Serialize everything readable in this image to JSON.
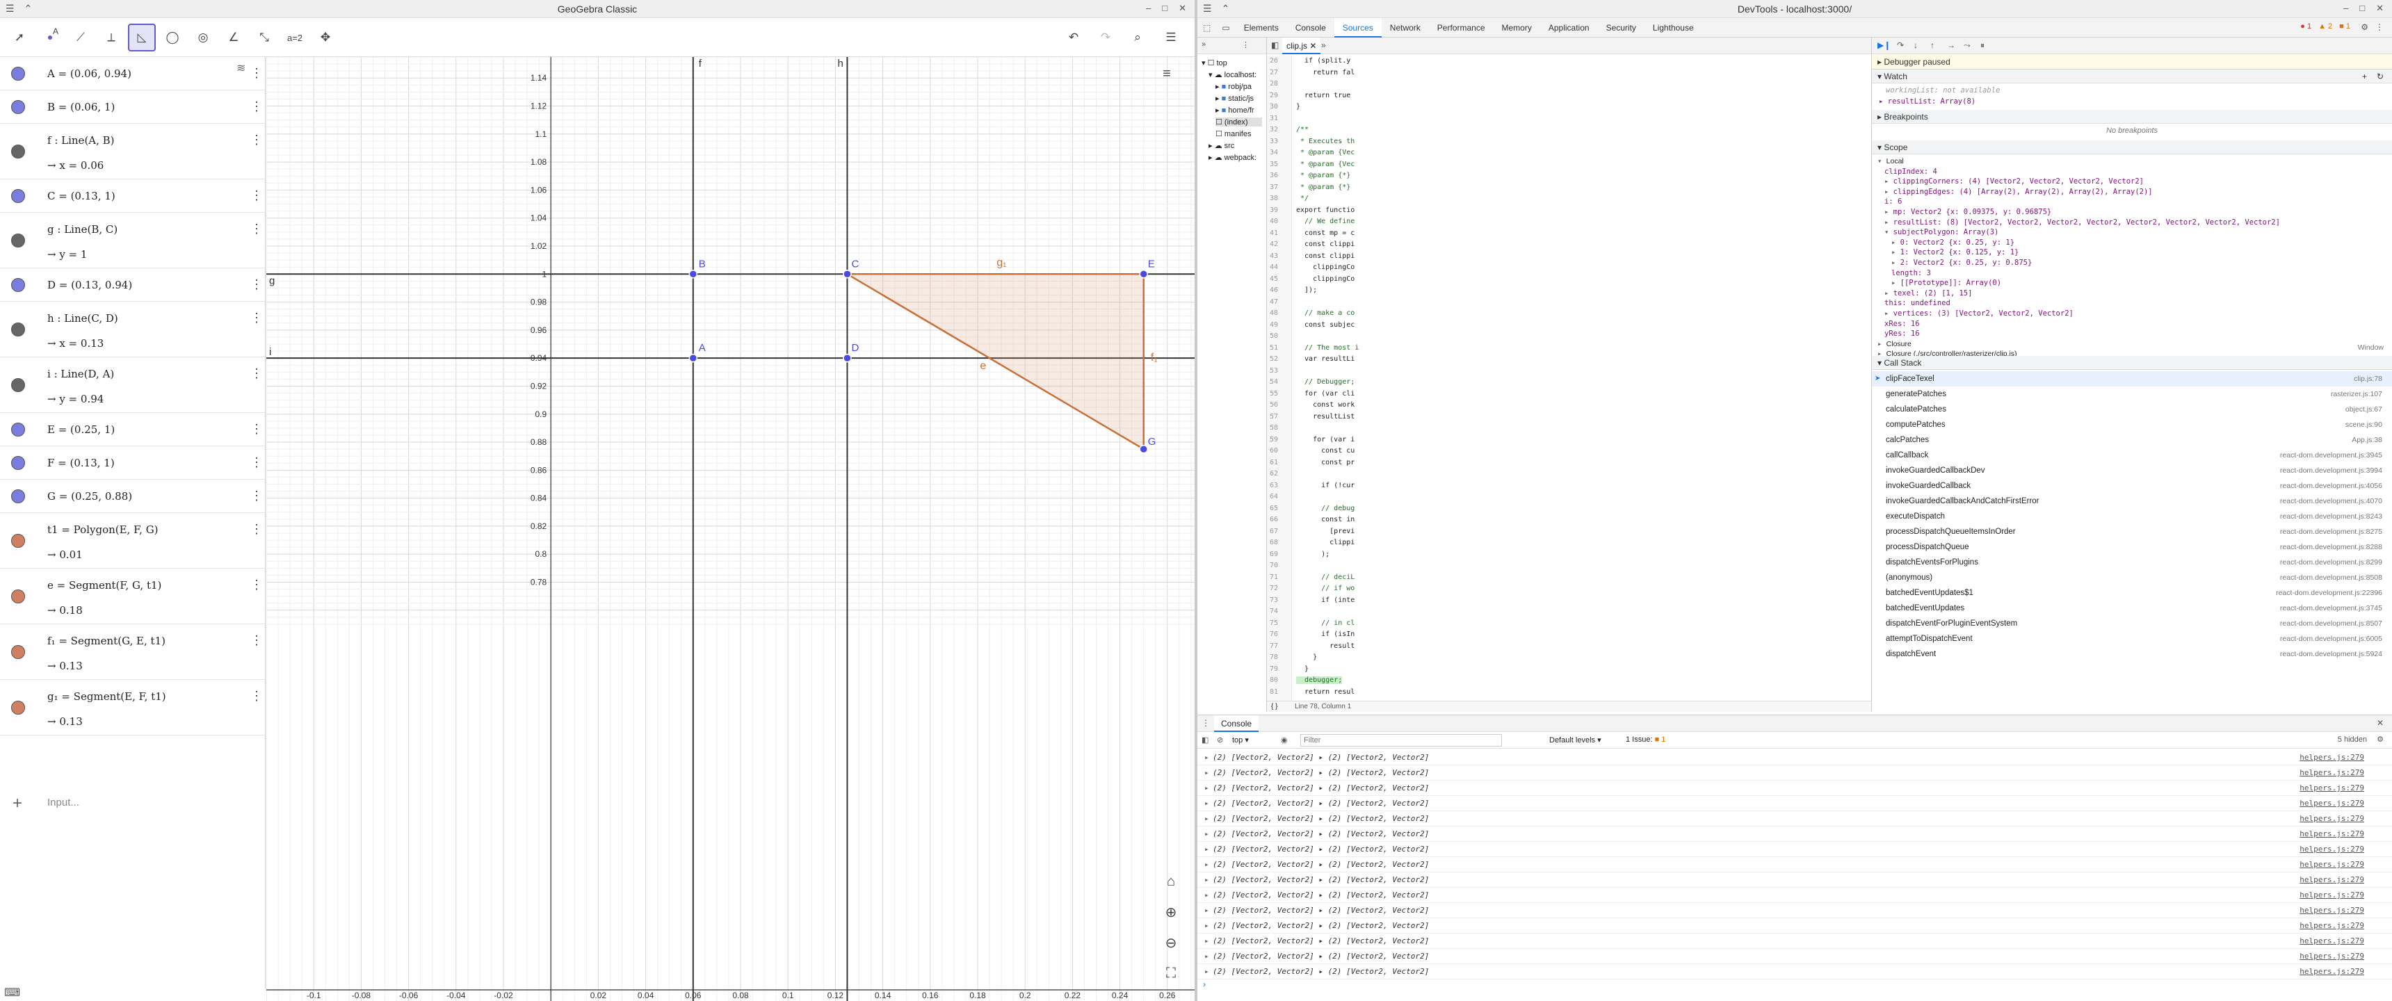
{
  "geogebra": {
    "title": "GeoGebra Classic",
    "algebra": [
      {
        "def": "A = (0.06, 0.94)",
        "val": "",
        "color": "#7c7ce0"
      },
      {
        "def": "B = (0.06, 1)",
        "val": "",
        "color": "#7c7ce0"
      },
      {
        "def": "f : Line(A, B)",
        "val": "→  x = 0.06",
        "color": "#666666"
      },
      {
        "def": "C = (0.13, 1)",
        "val": "",
        "color": "#7c7ce0"
      },
      {
        "def": "g : Line(B, C)",
        "val": "→  y = 1",
        "color": "#666666"
      },
      {
        "def": "D = (0.13, 0.94)",
        "val": "",
        "color": "#7c7ce0"
      },
      {
        "def": "h : Line(C, D)",
        "val": "→  x = 0.13",
        "color": "#666666"
      },
      {
        "def": "i : Line(D, A)",
        "val": "→  y = 0.94",
        "color": "#666666"
      },
      {
        "def": "E = (0.25, 1)",
        "val": "",
        "color": "#7c7ce0"
      },
      {
        "def": "F = (0.13, 1)",
        "val": "",
        "color": "#7c7ce0"
      },
      {
        "def": "G = (0.25, 0.88)",
        "val": "",
        "color": "#7c7ce0"
      },
      {
        "def": "t1 = Polygon(E, F, G)",
        "val": "→  0.01",
        "color": "#d08060"
      },
      {
        "def": "e = Segment(F, G, t1)",
        "val": "→  0.18",
        "color": "#d08060"
      },
      {
        "def": "f₁ = Segment(G, E, t1)",
        "val": "→  0.13",
        "color": "#d08060"
      },
      {
        "def": "g₁ = Segment(E, F, t1)",
        "val": "→  0.13",
        "color": "#d08060"
      }
    ],
    "input_placeholder": "Input...",
    "xticks": [
      "-0.1",
      "-0.08",
      "-0.06",
      "-0.04",
      "-0.02",
      "0.02",
      "0.04",
      "0.06",
      "0.08",
      "0.1",
      "0.12",
      "0.14",
      "0.16",
      "0.18",
      "0.2",
      "0.22",
      "0.24",
      "0.26"
    ],
    "yticks": [
      "1.14",
      "1.12",
      "1.1",
      "1.08",
      "1.06",
      "1.04",
      "1.02",
      "1",
      "0.98",
      "0.96",
      "0.94",
      "0.92",
      "0.9",
      "0.88",
      "0.86",
      "0.84",
      "0.82",
      "0.8",
      "0.78"
    ],
    "line_labels": {
      "f": "f",
      "h": "h",
      "g": "g",
      "i": "i"
    },
    "point_labels": {
      "A": "A",
      "B": "B",
      "C": "C",
      "D": "D",
      "E": "E",
      "G": "G"
    },
    "segment_labels": {
      "e": "e",
      "f1": "f₁",
      "g1": "g₁"
    },
    "colors": {
      "point": "#4a4ae0",
      "polygon": "#c8703a",
      "polygon_fill": "rgba(214,150,110,0.2)"
    }
  },
  "devtools": {
    "title": "DevTools - localhost:3000/",
    "tabs": [
      "Elements",
      "Console",
      "Sources",
      "Network",
      "Performance",
      "Memory",
      "Application",
      "Security",
      "Lighthouse"
    ],
    "active_tab": "Sources",
    "badges": {
      "errors": "1",
      "warnings": "2",
      "issues": "1"
    },
    "file_tab": "clip.js",
    "nav": [
      "top",
      "localhost:",
      "robj/pa",
      "static/js",
      "home/fr",
      "(index)",
      "manifes",
      "src",
      "webpack:"
    ],
    "line_numbers": [
      "26",
      "27",
      "28",
      "29",
      "30",
      "31",
      "32",
      "33",
      "34",
      "35",
      "36",
      "37",
      "38",
      "39",
      "40",
      "41",
      "42",
      "43",
      "44",
      "45",
      "46",
      "47",
      "48",
      "49",
      "50",
      "51",
      "52",
      "53",
      "54",
      "55",
      "56",
      "57",
      "58",
      "59",
      "60",
      "61",
      "62",
      "63",
      "64",
      "65",
      "66",
      "67",
      "68",
      "69",
      "70",
      "71",
      "72",
      "73",
      "74",
      "75",
      "76",
      "77",
      "78",
      "79",
      "80",
      "81"
    ],
    "code_lines": [
      "  if (split.y",
      "    return fal",
      "",
      "  return true",
      "}",
      "",
      "/**",
      " * Executes th",
      " * @param {Vec",
      " * @param {Vec",
      " * @param {*}",
      " * @param {*}",
      " */",
      "export functio",
      "  // We define",
      "  const mp = c",
      "  const clippi",
      "  const clippi",
      "    clippingCo",
      "    clippingCo",
      "  ]);",
      "",
      "  // make a co",
      "  const subjec",
      "",
      "  // The most i",
      "  var resultLi",
      "",
      "  // Debugger;",
      "  for (var cli",
      "    const work",
      "    resultList",
      "",
      "    for (var i",
      "      const cu",
      "      const pr",
      "",
      "      if (!cur",
      "",
      "      // debug",
      "      const in",
      "        [previ",
      "        clippi",
      "      );",
      "",
      "      // deciL",
      "      // if wo",
      "      if (inte",
      "",
      "      // in cl",
      "      if (isIn",
      "        result",
      "    }",
      "  }",
      "  debugger;",
      "  return resul",
      "}"
    ],
    "status": "Line 78, Column 1",
    "paused": "Debugger paused",
    "watch_title": "Watch",
    "watch": [
      "workingList: not available",
      "resultList: Array(8)"
    ],
    "breakpoints_title": "Breakpoints",
    "no_breakpoints": "No breakpoints",
    "scope_title": "Scope",
    "scope": [
      "Local",
      "clipIndex: 4",
      "clippingCorners: (4) [Vector2, Vector2, Vector2, Vector2]",
      "clippingEdges: (4) [Array(2), Array(2), Array(2), Array(2)]",
      "i: 6",
      "mp: Vector2 {x: 0.09375, y: 0.96875}",
      "resultList: (8) [Vector2, Vector2, Vector2, Vector2, Vector2, Vector2, Vector2, Vector2]",
      "subjectPolygon: Array(3)",
      "0: Vector2 {x: 0.25, y: 1}",
      "1: Vector2 {x: 0.125, y: 1}",
      "2: Vector2 {x: 0.25, y: 0.875}",
      "length: 3",
      "[[Prototype]]: Array(0)",
      "texel: (2) [1, 15]",
      "this: undefined",
      "vertices: (3) [Vector2, Vector2, Vector2]",
      "xRes: 16",
      "yRes: 16",
      "Closure",
      "Closure (./src/controller/rasterizer/clip.js)",
      "Global"
    ],
    "window_label": "Window",
    "callstack_title": "Call Stack",
    "callstack": [
      {
        "fn": "clipFaceTexel",
        "loc": "clip.js:78"
      },
      {
        "fn": "generatePatches",
        "loc": "rasterizer.js:107"
      },
      {
        "fn": "calculatePatches",
        "loc": "object.js:67"
      },
      {
        "fn": "computePatches",
        "loc": "scene.js:90"
      },
      {
        "fn": "calcPatches",
        "loc": "App.js:38"
      },
      {
        "fn": "callCallback",
        "loc": "react-dom.development.js:3945"
      },
      {
        "fn": "invokeGuardedCallbackDev",
        "loc": "react-dom.development.js:3994"
      },
      {
        "fn": "invokeGuardedCallback",
        "loc": "react-dom.development.js:4056"
      },
      {
        "fn": "invokeGuardedCallbackAndCatchFirstError",
        "loc": "react-dom.development.js:4070"
      },
      {
        "fn": "executeDispatch",
        "loc": "react-dom.development.js:8243"
      },
      {
        "fn": "processDispatchQueueItemsInOrder",
        "loc": "react-dom.development.js:8275"
      },
      {
        "fn": "processDispatchQueue",
        "loc": "react-dom.development.js:8288"
      },
      {
        "fn": "dispatchEventsForPlugins",
        "loc": "react-dom.development.js:8299"
      },
      {
        "fn": "(anonymous)",
        "loc": "react-dom.development.js:8508"
      },
      {
        "fn": "batchedEventUpdates$1",
        "loc": "react-dom.development.js:22396"
      },
      {
        "fn": "batchedEventUpdates",
        "loc": "react-dom.development.js:3745"
      },
      {
        "fn": "dispatchEventForPluginEventSystem",
        "loc": "react-dom.development.js:8507"
      },
      {
        "fn": "attemptToDispatchEvent",
        "loc": "react-dom.development.js:6005"
      },
      {
        "fn": "dispatchEvent",
        "loc": "react-dom.development.js:5924"
      }
    ],
    "console": {
      "tab": "Console",
      "context": "top",
      "filter_placeholder": "Filter",
      "levels": "Default levels",
      "issues": "1 Issue:",
      "issue_count": "1",
      "hidden": "5 hidden",
      "row_text": "(2) [Vector2, Vector2]  ▸ (2) [Vector2, Vector2]",
      "row_link": "helpers.js:279",
      "row_count": 15
    }
  }
}
